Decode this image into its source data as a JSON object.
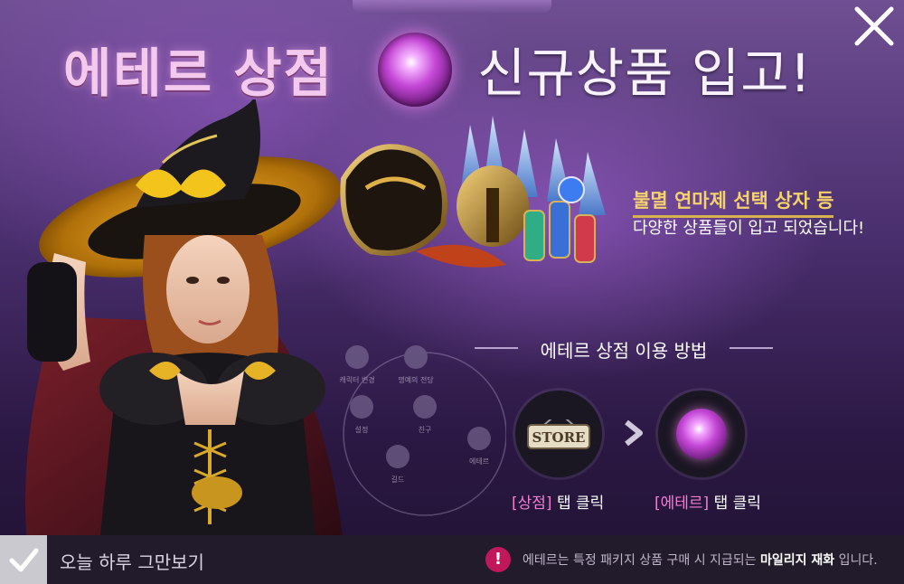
{
  "title": {
    "left": "에테르 상점",
    "right": "신규상품 입고!"
  },
  "promo": {
    "line1": "불멸 연마제 선택 상자 등",
    "line2": "다양한 상품들이 입고 되었습니다!"
  },
  "howto": {
    "title": "에테르 상점 이용 방법"
  },
  "menu_ghost": {
    "items": [
      "캐릭터 변경",
      "명예의 전당",
      "설정",
      "친구",
      "에테르",
      "길드"
    ]
  },
  "steps": [
    {
      "icon": "store-sign-icon",
      "sign_text": "STORE",
      "label_highlight": "[상점]",
      "label_rest": " 탭 클릭"
    },
    {
      "icon": "aether-orb-icon",
      "label_highlight": "[에테르]",
      "label_rest": " 탭 클릭"
    }
  ],
  "bottom": {
    "dismiss_label": "오늘 하루 그만보기",
    "notice_icon": "!",
    "notice_prefix": "에테르는 특정 패키지 상품 구매 시 지급되는 ",
    "notice_bold": "마일리지 재화",
    "notice_suffix": " 입니다."
  },
  "colors": {
    "accent_pink": "#f07fd2",
    "promo_gold": "#f3d36a",
    "notice_red": "#c1185b"
  }
}
